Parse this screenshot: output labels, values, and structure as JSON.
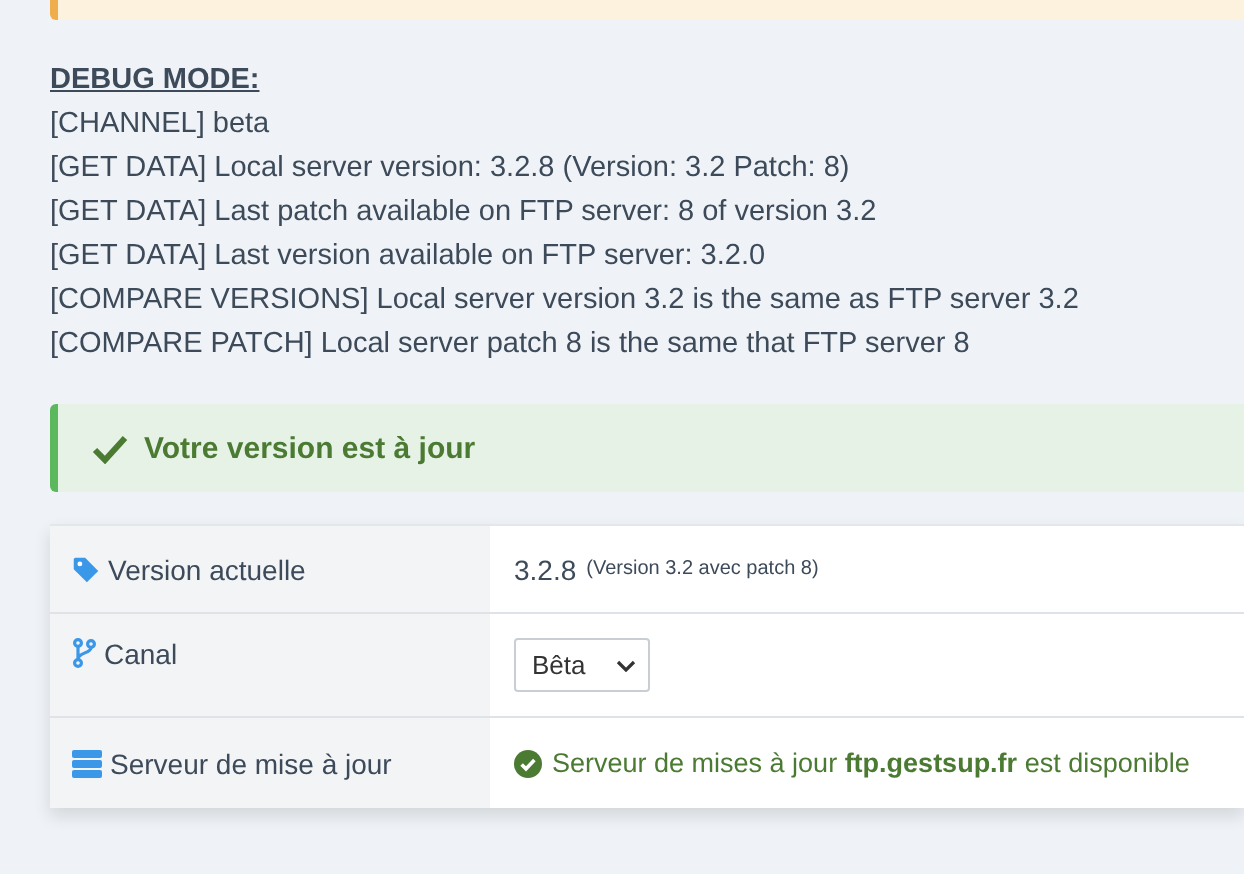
{
  "debug": {
    "title": "DEBUG MODE:",
    "lines": [
      "[CHANNEL] beta",
      "[GET DATA] Local server version: 3.2.8 (Version: 3.2 Patch: 8)",
      "[GET DATA] Last patch available on FTP server: 8 of version 3.2",
      "[GET DATA] Last version available on FTP server: 3.2.0",
      "[COMPARE VERSIONS] Local server version 3.2 is the same as FTP server 3.2",
      "[COMPARE PATCH] Local server patch 8 is the same that FTP server 8"
    ]
  },
  "alert": {
    "text": "Votre version est à jour"
  },
  "settings": [
    {
      "kind": "version",
      "label": "Version actuelle",
      "value": "3.2.8",
      "note": "(Version 3.2 avec patch 8)"
    },
    {
      "kind": "select",
      "label": "Canal",
      "value": "Bêta"
    },
    {
      "kind": "status",
      "label": "Serveur de mise à jour",
      "text": "Serveur de mises à jour **ftp.gestsup.fr** est disponible"
    }
  ]
}
